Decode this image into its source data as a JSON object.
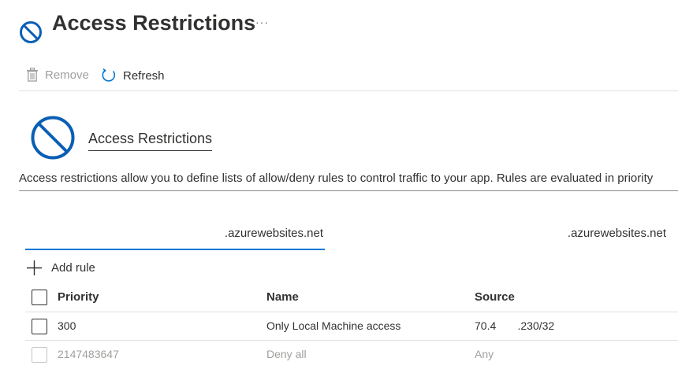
{
  "header": {
    "title": "Access Restrictions",
    "more": "···"
  },
  "toolbar": {
    "remove_label": "Remove",
    "refresh_label": "Refresh"
  },
  "section": {
    "title": "Access Restrictions",
    "description": "Access restrictions allow you to define lists of allow/deny rules to control traffic to your app. Rules are evaluated in priority"
  },
  "tabs": [
    {
      "label": ".azurewebsites.net",
      "selected": true
    },
    {
      "label": ".azurewebsites.net",
      "selected": false
    }
  ],
  "add_rule_label": "Add rule",
  "table": {
    "columns": [
      "Priority",
      "Name",
      "Source"
    ],
    "rows": [
      {
        "priority": "300",
        "name": "Only Local Machine access",
        "source": "70.4       .230/32",
        "disabled": false
      },
      {
        "priority": "2147483647",
        "name": "Deny all",
        "source": "Any",
        "disabled": true
      }
    ]
  },
  "colors": {
    "accent": "#0078d4",
    "icon_blue": "#0a5fb4",
    "text": "#323130",
    "disabled_text": "#a19f9d"
  },
  "icons": {
    "header": "blocked-circle-icon",
    "remove": "trash-icon",
    "refresh": "refresh-icon",
    "add": "plus-icon"
  }
}
